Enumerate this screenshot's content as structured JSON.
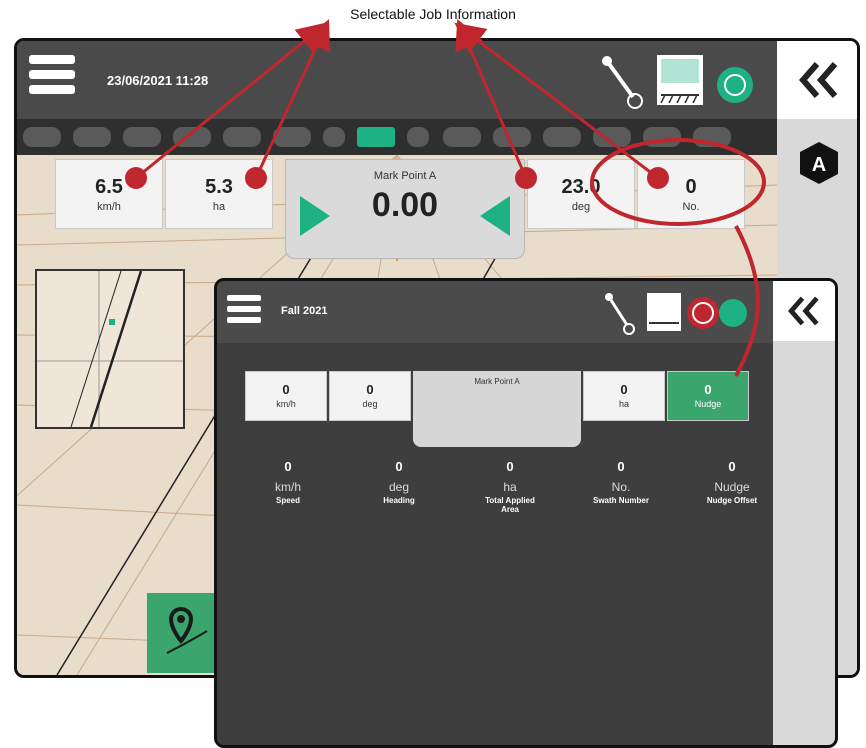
{
  "callout": {
    "title": "Selectable Job Information"
  },
  "back_screen": {
    "datetime": "23/06/2021 11:28",
    "job_items": [
      {
        "value": "6.5",
        "unit": "km/h"
      },
      {
        "value": "5.3",
        "unit": "ha"
      },
      {
        "value": "23.0",
        "unit": "deg"
      },
      {
        "value": "0",
        "unit": "No."
      }
    ],
    "center": {
      "label": "Mark Point A",
      "value": "0.00"
    },
    "mode_badge": "A",
    "boom_sections": 15,
    "active_section": 7
  },
  "front_screen": {
    "job_name": "Fall 2021",
    "center": {
      "label": "Mark Point A"
    },
    "strip": [
      {
        "value": "0",
        "unit": "km/h"
      },
      {
        "value": "0",
        "unit": "deg"
      },
      {
        "value": "0",
        "unit": "ha"
      },
      {
        "value": "0",
        "unit": "Nudge"
      }
    ],
    "options": [
      {
        "value": "0",
        "unit": "km/h",
        "name": "Speed"
      },
      {
        "value": "0",
        "unit": "deg",
        "name": "Heading"
      },
      {
        "value": "0",
        "unit": "ha",
        "name": "Total Applied Area"
      },
      {
        "value": "0",
        "unit": "No.",
        "name": "Swath Number"
      },
      {
        "value": "0",
        "unit": "Nudge",
        "name": "Nudge Offset"
      }
    ]
  },
  "colors": {
    "accent_green": "#1db184",
    "callout_red": "#c0262d",
    "topbar": "#4a4a4a"
  }
}
